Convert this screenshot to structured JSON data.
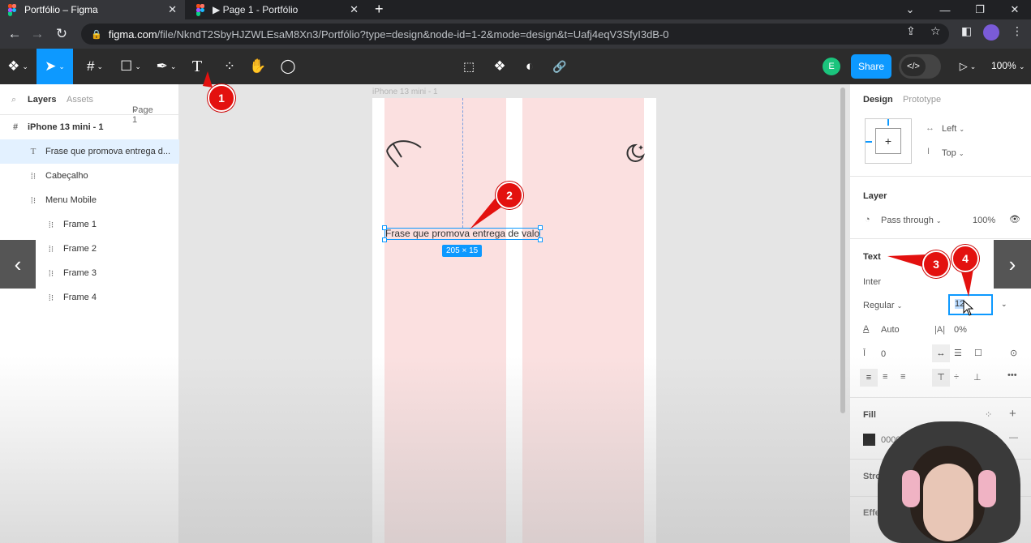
{
  "browser": {
    "tabs": [
      {
        "title": "Portfólio – Figma",
        "active": true
      },
      {
        "title": "▶ Page 1 - Portfólio",
        "active": false
      }
    ],
    "url_host": "figma.com",
    "url_path": "/file/NkndT2SbyHJZWLEsaM8Xn3/Portfólio?type=design&node-id=1-2&mode=design&t=Uafj4eqV3SfyI3dB-0"
  },
  "toolbar": {
    "share_label": "Share",
    "avatar_initial": "E",
    "zoom_label": "100%",
    "dev_mode_glyph": "</>"
  },
  "left_panel": {
    "tab_layers": "Layers",
    "tab_assets": "Assets",
    "page_selector": "Page 1",
    "layers": [
      {
        "name": "iPhone 13 mini - 1",
        "icon": "frame-icon"
      },
      {
        "name": "Frase que promova entrega d...",
        "icon": "text-icon"
      },
      {
        "name": "Cabeçalho",
        "icon": "auto-layout-icon"
      },
      {
        "name": "Menu Mobile",
        "icon": "auto-layout-icon"
      },
      {
        "name": "Frame 1",
        "icon": "auto-layout-icon"
      },
      {
        "name": "Frame 2",
        "icon": "auto-layout-icon"
      },
      {
        "name": "Frame 3",
        "icon": "auto-layout-icon"
      },
      {
        "name": "Frame 4",
        "icon": "auto-layout-icon"
      }
    ]
  },
  "canvas": {
    "frame_label": "iPhone 13 mini - 1",
    "text_content": "Frase que promova entrega de valor",
    "dimensions_badge": "205 × 15"
  },
  "right_panel": {
    "tab_design": "Design",
    "tab_prototype": "Prototype",
    "constraint_h": "Left",
    "constraint_v": "Top",
    "layer_title": "Layer",
    "blend_mode": "Pass through",
    "opacity": "100%",
    "text_title": "Text",
    "font_family": "Inter",
    "font_weight": "Regular",
    "font_size": "12",
    "line_height": "Auto",
    "letter_spacing": "0%",
    "paragraph_spacing": "0",
    "fill_title": "Fill",
    "fill_hex": "00000",
    "stroke_title": "Stro",
    "effects_title": "Effe"
  },
  "annotations": [
    "1",
    "2",
    "3",
    "4"
  ],
  "colors": {
    "accent": "#0d99ff",
    "annotation_red": "#e3110f",
    "toolbar_bg": "#2c2c2c",
    "column_pink": "#fbe0e0"
  }
}
